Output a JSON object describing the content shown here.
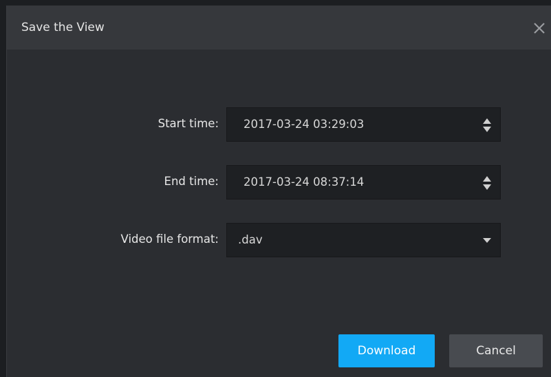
{
  "dialog": {
    "title": "Save the View"
  },
  "form": {
    "start_time": {
      "label": "Start time:",
      "value": "2017-03-24 03:29:03"
    },
    "end_time": {
      "label": "End time:",
      "value": "2017-03-24 08:37:14"
    },
    "video_format": {
      "label": "Video file format:",
      "value": ".dav"
    }
  },
  "buttons": {
    "download": "Download",
    "cancel": "Cancel"
  },
  "icons": {
    "close": "close-icon",
    "spinner": "up-down-spinner-icon",
    "dropdown": "chevron-down-icon"
  },
  "colors": {
    "accent": "#12a9f5",
    "background": "#2b2d31",
    "titlebar": "#36383c",
    "field": "#1e2023",
    "cancel": "#484b50"
  }
}
